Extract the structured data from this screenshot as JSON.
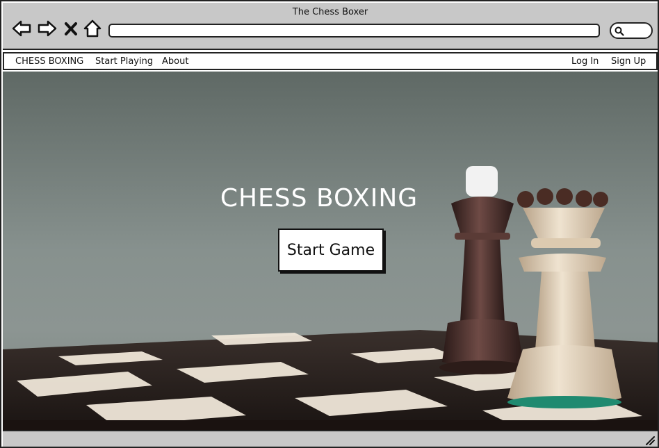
{
  "window": {
    "title": "The Chess Boxer"
  },
  "browser": {
    "back_icon": "back-arrow-icon",
    "forward_icon": "forward-arrow-icon",
    "close_icon": "close-icon",
    "home_icon": "home-icon",
    "url_value": "",
    "search_icon": "search-icon"
  },
  "site_nav": {
    "brand": "CHESS BOXING",
    "links": [
      "Start Playing",
      "About"
    ],
    "login": "Log In",
    "signup": "Sign Up"
  },
  "hero": {
    "title": "CHESS BOXING",
    "button_label": "Start Game"
  },
  "colors": {
    "chrome_bg": "#c8c8c8",
    "outline": "#222222",
    "hero_text": "#ffffff"
  }
}
